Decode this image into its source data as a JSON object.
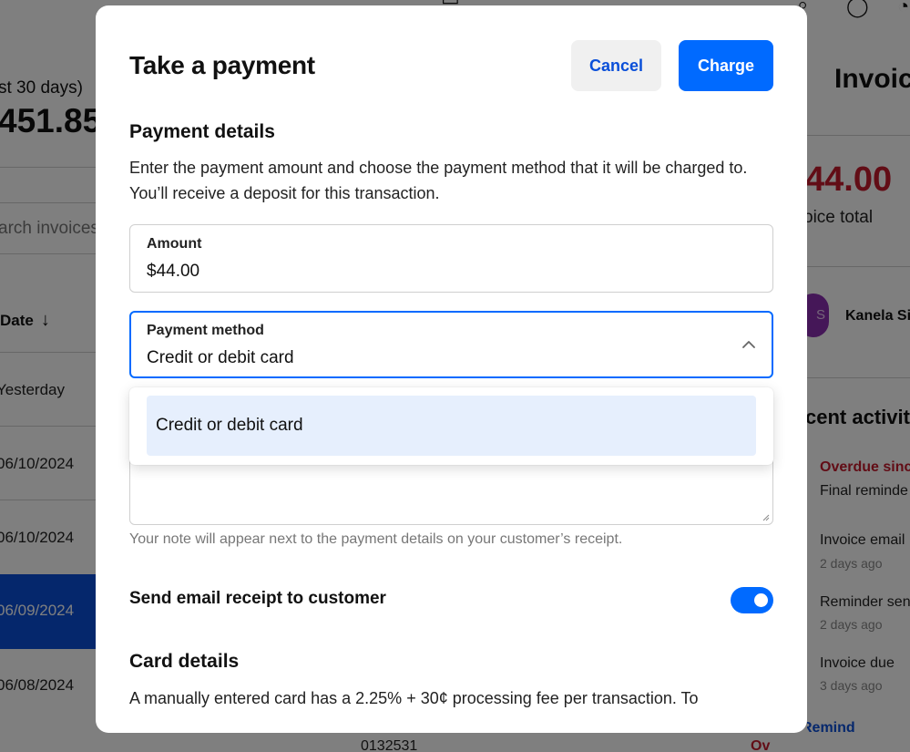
{
  "background": {
    "sales_period": "st 30 days)",
    "sales_total": "451.85",
    "search_placeholder": "arch invoices",
    "table_header_date": "Date",
    "rows": [
      "Yesterday",
      "06/10/2024",
      "06/10/2024",
      "06/09/2024",
      "06/08/2024"
    ],
    "bottom_id": "0132531",
    "bottom_status": "Ov",
    "invoice_title": "Invoic",
    "invoice_amount": "44.00",
    "invoice_total_label": "oice total",
    "customer_initial": "S",
    "customer_name": "Kanela Si",
    "recent_activity_title": "cent activit",
    "activities": [
      {
        "title": "Overdue sinc",
        "subtitle": "Final reminde",
        "overdue": true
      },
      {
        "title": "Invoice email",
        "time": "2 days ago"
      },
      {
        "title": "Reminder sen",
        "time": "2 days ago"
      },
      {
        "title": "Invoice due",
        "time": "3 days ago"
      }
    ],
    "remind_link": "Remind"
  },
  "modal": {
    "title": "Take a payment",
    "cancel_label": "Cancel",
    "charge_label": "Charge",
    "payment_details_title": "Payment details",
    "payment_details_desc": "Enter the payment amount and choose the payment method that it will be charged to. You’ll receive a deposit for this transaction.",
    "amount": {
      "label": "Amount",
      "value": "$44.00"
    },
    "payment_method": {
      "label": "Payment method",
      "value": "Credit or debit card",
      "expanded": true
    },
    "dropdown_options": [
      "Credit or debit card"
    ],
    "note_help": "Your note will appear next to the payment details on your customer’s receipt.",
    "email_receipt": {
      "label": "Send email receipt to customer",
      "enabled": true
    },
    "card_details_title": "Card details",
    "card_details_desc": "A manually entered card has a 2.25% + 30¢ processing fee per transaction. To"
  },
  "colors": {
    "accent": "#006aff",
    "overdue": "#c41a2c",
    "selected_row": "#0a4fd9"
  },
  "icons": [
    "arrow-down-icon",
    "search-icon",
    "messages-icon",
    "notification-icon",
    "chevron-up-icon"
  ]
}
